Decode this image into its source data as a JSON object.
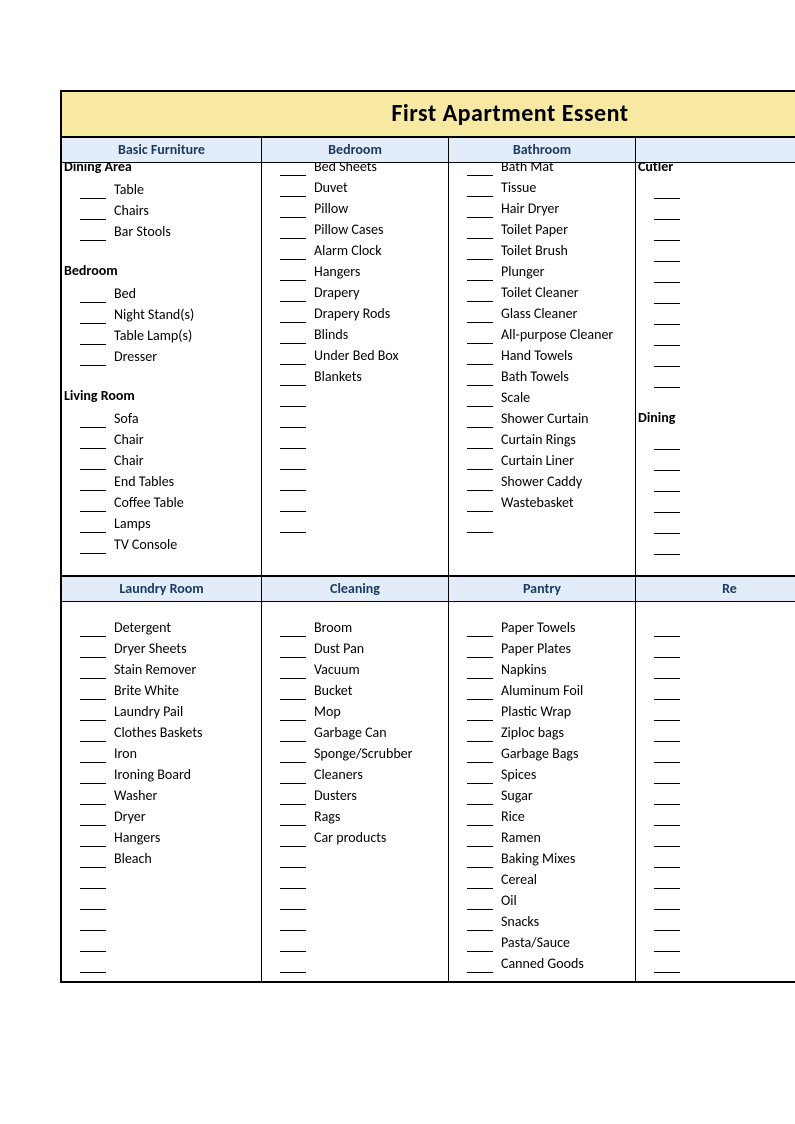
{
  "title": "First Apartment Essent",
  "sections": [
    {
      "columns": [
        {
          "header": "Basic Furniture",
          "groups": [
            {
              "subhead": "Dining Area",
              "items": [
                "Table",
                "Chairs",
                "Bar Stools"
              ]
            },
            {
              "subhead": "Bedroom",
              "items": [
                "Bed",
                "Night Stand(s)",
                "Table Lamp(s)",
                "Dresser"
              ]
            },
            {
              "subhead": "Living Room",
              "items": [
                "Sofa",
                "Chair",
                "Chair",
                "End Tables",
                "Coffee Table",
                "Lamps",
                "TV Console"
              ]
            }
          ]
        },
        {
          "header": "Bedroom",
          "groups": [
            {
              "subhead": "",
              "items": [
                "Bed Sheets",
                "Duvet",
                "Pillow",
                "Pillow Cases",
                "Alarm Clock",
                "Hangers",
                "Drapery",
                "Drapery Rods",
                "Blinds",
                "Under Bed Box",
                "Blankets",
                "",
                "",
                "",
                "",
                "",
                "",
                ""
              ]
            }
          ]
        },
        {
          "header": "Bathroom",
          "groups": [
            {
              "subhead": "",
              "items": [
                "Bath Mat",
                "Tissue",
                "Hair Dryer",
                "Toilet Paper",
                "Toilet Brush",
                "Plunger",
                "Toilet Cleaner",
                "Glass Cleaner",
                "All-purpose Cleaner",
                "Hand Towels",
                "Bath Towels",
                "Scale",
                "Shower Curtain",
                "Curtain Rings",
                "Curtain Liner",
                "Shower Caddy",
                "Wastebasket",
                ""
              ]
            }
          ]
        },
        {
          "header": "",
          "groups": [
            {
              "subhead": "Cutler",
              "items": [
                "",
                "",
                "",
                "",
                "",
                "",
                "",
                "",
                "",
                ""
              ]
            },
            {
              "subhead": "Dining",
              "items": [
                "",
                "",
                "",
                "",
                "",
                ""
              ]
            }
          ]
        }
      ]
    },
    {
      "columns": [
        {
          "header": "Laundry Room",
          "groups": [
            {
              "subhead": "",
              "items": [
                "Detergent",
                "Dryer Sheets",
                "Stain Remover",
                "Brite White",
                "Laundry Pail",
                "Clothes Baskets",
                "Iron",
                "Ironing Board",
                "Washer",
                "Dryer",
                "Hangers",
                "Bleach",
                "",
                "",
                "",
                "",
                ""
              ]
            }
          ]
        },
        {
          "header": "Cleaning",
          "groups": [
            {
              "subhead": "",
              "items": [
                "Broom",
                "Dust Pan",
                "Vacuum",
                "Bucket",
                "Mop",
                "Garbage Can",
                "Sponge/Scrubber",
                "Cleaners",
                "Dusters",
                "Rags",
                "Car products",
                "",
                "",
                "",
                "",
                "",
                ""
              ]
            }
          ]
        },
        {
          "header": "Pantry",
          "groups": [
            {
              "subhead": "",
              "items": [
                "Paper Towels",
                "Paper Plates",
                "Napkins",
                "Aluminum Foil",
                "Plastic Wrap",
                "Ziploc bags",
                "Garbage Bags",
                "Spices",
                "Sugar",
                "Rice",
                "Ramen",
                "Baking Mixes",
                "Cereal",
                "Oil",
                "Snacks",
                "Pasta/Sauce",
                "Canned Goods"
              ]
            }
          ]
        },
        {
          "header": "Re",
          "groups": [
            {
              "subhead": "",
              "items": [
                "",
                "",
                "",
                "",
                "",
                "",
                "",
                "",
                "",
                "",
                "",
                "",
                "",
                "",
                "",
                "",
                ""
              ]
            }
          ]
        }
      ]
    }
  ]
}
